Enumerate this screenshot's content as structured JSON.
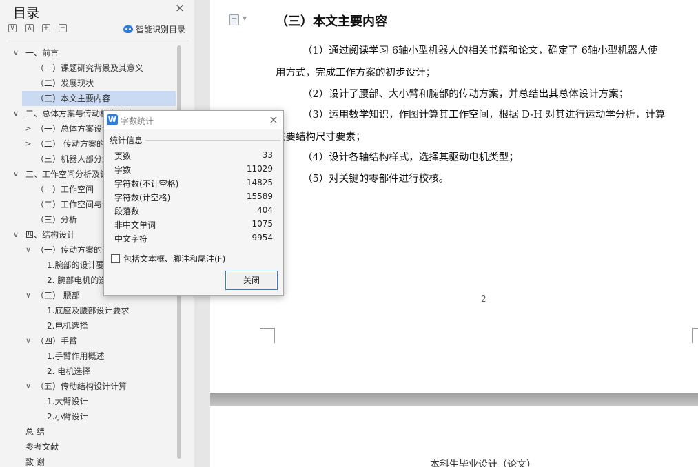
{
  "toc": {
    "title": "目录",
    "smart_label": "智能识别目录",
    "items": [
      {
        "label": "一、前言",
        "chevron": "∨",
        "level": 0
      },
      {
        "label": "（一）课题研究背景及其意义",
        "chevron": "",
        "level": 1
      },
      {
        "label": "（二）发展现状",
        "chevron": "",
        "level": 1
      },
      {
        "label": "（三）本文主要内容",
        "chevron": "",
        "level": 1,
        "selected": true
      },
      {
        "label": "二、总体方案与传动机构设计",
        "chevron": "∨",
        "level": 0
      },
      {
        "label": "（一）总体方案设计",
        "chevron": ">",
        "level": 1
      },
      {
        "label": "（二） 传动方案的选择",
        "chevron": ">",
        "level": 1
      },
      {
        "label": "（三）机器人部分结构",
        "chevron": "",
        "level": 1
      },
      {
        "label": "三、工作空间分析及计算",
        "chevron": "∨",
        "level": 0
      },
      {
        "label": "（一）工作空间",
        "chevron": "",
        "level": 1
      },
      {
        "label": "（二）工作空间与计算",
        "chevron": "",
        "level": 1
      },
      {
        "label": "（三）分析",
        "chevron": "",
        "level": 1
      },
      {
        "label": "四、结构设计",
        "chevron": "∨",
        "level": 0
      },
      {
        "label": "（一）传动方案的选择",
        "chevron": "∨",
        "level": 1
      },
      {
        "label": "1.腕部的设计要求",
        "chevron": "",
        "level": 2
      },
      {
        "label": "2. 腕部电机的选择",
        "chevron": "",
        "level": 2
      },
      {
        "label": "（三） 腰部",
        "chevron": "∨",
        "level": 1
      },
      {
        "label": "1.底座及腰部设计要求",
        "chevron": "",
        "level": 2
      },
      {
        "label": "2.电机选择",
        "chevron": "",
        "level": 2
      },
      {
        "label": "（四）手臂",
        "chevron": "∨",
        "level": 1
      },
      {
        "label": "1.手臂作用概述",
        "chevron": "",
        "level": 2
      },
      {
        "label": "2. 电机选择",
        "chevron": "",
        "level": 2
      },
      {
        "label": "（五）传动结构设计计算",
        "chevron": "∨",
        "level": 1
      },
      {
        "label": "1.大臂设计",
        "chevron": "",
        "level": 2
      },
      {
        "label": "2.小臂设计",
        "chevron": "",
        "level": 2
      },
      {
        "label": "总  结",
        "chevron": "",
        "level": 0
      },
      {
        "label": "参考文献",
        "chevron": "",
        "level": 0
      },
      {
        "label": "致  谢",
        "chevron": "",
        "level": 0
      }
    ]
  },
  "document": {
    "heading": "（三）本文主要内容",
    "paragraphs": [
      "（1）通过阅读学习 6轴小型机器人的相关书籍和论文，确定了 6轴小型机器人使",
      "用方式，完成工作方案的初步设计；",
      "（2）设计了腰部、大小臂和腕部的传动方案，并总结出其总体设计方案；",
      "（3）运用数学知识，作图计算其工作空间，根据 D-H 对其进行运动学分析，计算",
      "主要结构尺寸要素；",
      "（4）设计各轴结构样式，选择其驱动电机类型；",
      "（5）对关键的零部件进行校核。"
    ],
    "page_number": "2",
    "next_page_header": "本科生毕业设计（论文）"
  },
  "dialog": {
    "title": "字数统计",
    "group_label": "统计信息",
    "stats": [
      {
        "key": "页数",
        "value": "33"
      },
      {
        "key": "字数",
        "value": "11029"
      },
      {
        "key": "字符数(不计空格)",
        "value": "14825"
      },
      {
        "key": "字符数(计空格)",
        "value": "15589"
      },
      {
        "key": "段落数",
        "value": "404"
      },
      {
        "key": "非中文单词",
        "value": "1075"
      },
      {
        "key": "中文字符",
        "value": "9954"
      }
    ],
    "include_label": "包括文本框、脚注和尾注(F)",
    "close_label": "关闭"
  }
}
